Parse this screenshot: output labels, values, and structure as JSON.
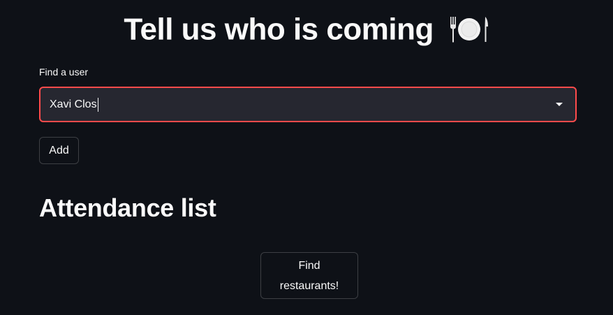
{
  "header": {
    "title": "Tell us who is coming",
    "title_icon": "fork-plate-knife-icon"
  },
  "user_select": {
    "label": "Find a user",
    "value": "Xavi Clos",
    "border_color": "#ff4b4b"
  },
  "add_button": {
    "label": "Add"
  },
  "attendance": {
    "heading": "Attendance list"
  },
  "find_button": {
    "label": "Find restaurants!"
  },
  "theme": {
    "background": "#0e1117",
    "input_background": "#262730",
    "text": "#fafafa"
  }
}
